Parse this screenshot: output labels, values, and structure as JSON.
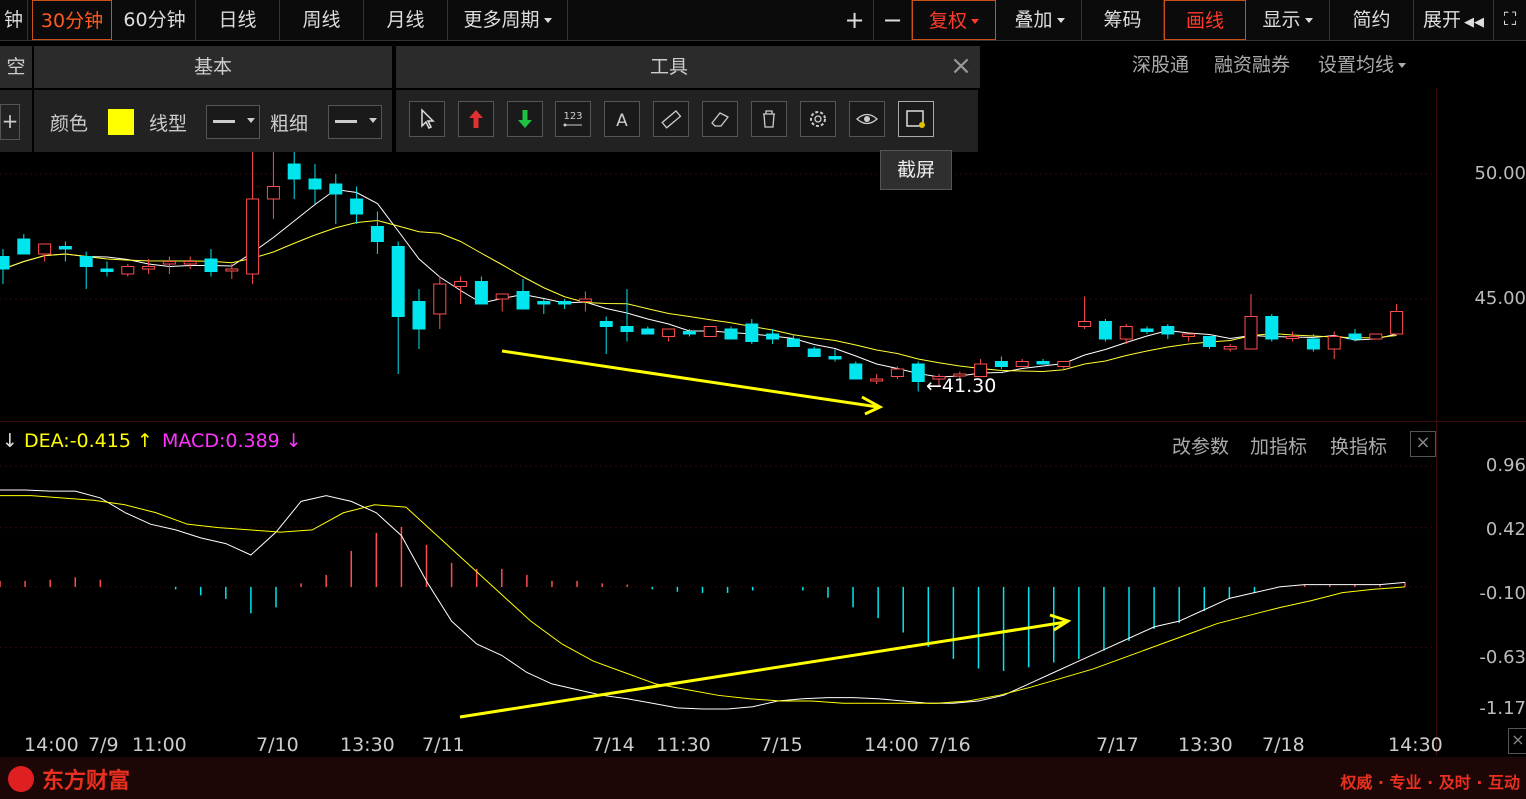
{
  "topbar": {
    "items": [
      {
        "label": "钟"
      },
      {
        "label": "30分钟",
        "active": true
      },
      {
        "label": "60分钟"
      },
      {
        "label": "日线"
      },
      {
        "label": "周线"
      },
      {
        "label": "月线"
      },
      {
        "label": "更多周期"
      }
    ],
    "right": {
      "plus": "+",
      "minus": "−",
      "fuquan": "复权",
      "diejia": "叠加",
      "chouma": "筹码",
      "huaxian": "画线",
      "xianshi": "显示",
      "jianyue": "简约",
      "zhankai": "展开"
    }
  },
  "draw_panel": {
    "tab_left": "空",
    "tab_basic": "基本",
    "tab_tools": "工具",
    "color_label": "颜色",
    "color_value": "#ffff00",
    "linetype_label": "线型",
    "thickness_label": "粗细",
    "tooltip": "截屏",
    "tools_icons": [
      "cursor-icon",
      "red-arrow-up-icon",
      "green-arrow-down-icon",
      "number-123-icon",
      "text-a-icon",
      "ruler-icon",
      "eraser-icon",
      "trash-icon",
      "settings-icon",
      "eye-icon",
      "screenshot-icon"
    ]
  },
  "chart_links": {
    "sgt": "深股通",
    "rzrq": "融资融券",
    "setma": "设置均线"
  },
  "price_axis": [
    "50.00",
    "45.00"
  ],
  "low_annotation": "←41.30",
  "macd_header": {
    "dea": "DEA:-0.415",
    "dea_arrow": "↑",
    "macd": "MACD:0.389",
    "macd_arrow": "↓",
    "left_arrow": "↓"
  },
  "macd_links": {
    "params": "改参数",
    "add": "加指标",
    "swap": "换指标"
  },
  "macd_axis": [
    "0.96",
    "0.42",
    "-0.10",
    "-0.63",
    "-1.17"
  ],
  "time_axis": [
    "14:00",
    "7/9",
    "11:00",
    "7/10",
    "13:30",
    "7/11",
    "7/14",
    "11:30",
    "7/15",
    "14:00",
    "7/16",
    "7/17",
    "13:30",
    "7/18",
    "14:30"
  ],
  "footer": {
    "brand": "东方财富",
    "slogan": "权威 · 专业 · 及时 · 互动"
  },
  "colors": {
    "up": "#ff4d4d",
    "down": "#00e5ee",
    "ma1": "#ffffff",
    "ma2": "#ffff33",
    "accent": "#ff5a1f",
    "dea": "#ffff00",
    "macd": "#ff00ff"
  },
  "chart_data": {
    "type": "candlestick",
    "yrange": [
      40,
      51
    ],
    "candles": [
      {
        "o": 46.7,
        "h": 47.0,
        "l": 45.6,
        "c": 46.2
      },
      {
        "o": 47.4,
        "h": 47.6,
        "l": 46.8,
        "c": 46.8
      },
      {
        "o": 46.8,
        "h": 47.2,
        "l": 46.5,
        "c": 47.2
      },
      {
        "o": 47.1,
        "h": 47.3,
        "l": 46.5,
        "c": 47.0
      },
      {
        "o": 46.7,
        "h": 46.9,
        "l": 45.4,
        "c": 46.3
      },
      {
        "o": 46.2,
        "h": 46.5,
        "l": 45.9,
        "c": 46.1
      },
      {
        "o": 46.0,
        "h": 46.4,
        "l": 45.9,
        "c": 46.3
      },
      {
        "o": 46.2,
        "h": 46.6,
        "l": 46.0,
        "c": 46.3
      },
      {
        "o": 46.4,
        "h": 46.7,
        "l": 46.0,
        "c": 46.5
      },
      {
        "o": 46.4,
        "h": 46.7,
        "l": 46.2,
        "c": 46.5
      },
      {
        "o": 46.6,
        "h": 47.0,
        "l": 45.9,
        "c": 46.1
      },
      {
        "o": 46.2,
        "h": 46.4,
        "l": 45.8,
        "c": 46.2
      },
      {
        "o": 46.0,
        "h": 51.0,
        "l": 45.6,
        "c": 49.0
      },
      {
        "o": 49.0,
        "h": 51.0,
        "l": 48.2,
        "c": 49.5
      },
      {
        "o": 50.4,
        "h": 51.0,
        "l": 49.0,
        "c": 49.8
      },
      {
        "o": 49.8,
        "h": 50.4,
        "l": 48.8,
        "c": 49.4
      },
      {
        "o": 49.6,
        "h": 50.0,
        "l": 48.0,
        "c": 49.2
      },
      {
        "o": 49.0,
        "h": 49.5,
        "l": 48.0,
        "c": 48.4
      },
      {
        "o": 47.9,
        "h": 48.5,
        "l": 46.8,
        "c": 47.3
      },
      {
        "o": 47.1,
        "h": 47.3,
        "l": 42.0,
        "c": 44.3
      },
      {
        "o": 44.9,
        "h": 45.4,
        "l": 43.0,
        "c": 43.8
      },
      {
        "o": 44.4,
        "h": 45.9,
        "l": 43.8,
        "c": 45.6
      },
      {
        "o": 45.5,
        "h": 45.9,
        "l": 44.8,
        "c": 45.7
      },
      {
        "o": 45.7,
        "h": 45.9,
        "l": 44.8,
        "c": 44.8
      },
      {
        "o": 45.0,
        "h": 45.2,
        "l": 44.5,
        "c": 45.2
      },
      {
        "o": 45.3,
        "h": 45.8,
        "l": 44.6,
        "c": 44.6
      },
      {
        "o": 44.9,
        "h": 45.0,
        "l": 44.4,
        "c": 44.8
      },
      {
        "o": 44.9,
        "h": 45.0,
        "l": 44.6,
        "c": 44.8
      },
      {
        "o": 44.9,
        "h": 45.3,
        "l": 44.5,
        "c": 45.0
      },
      {
        "o": 44.1,
        "h": 44.3,
        "l": 42.8,
        "c": 43.9
      },
      {
        "o": 43.9,
        "h": 45.4,
        "l": 43.3,
        "c": 43.7
      },
      {
        "o": 43.8,
        "h": 43.9,
        "l": 43.6,
        "c": 43.6
      },
      {
        "o": 43.5,
        "h": 43.8,
        "l": 43.3,
        "c": 43.8
      },
      {
        "o": 43.7,
        "h": 43.8,
        "l": 43.5,
        "c": 43.6
      },
      {
        "o": 43.5,
        "h": 43.9,
        "l": 43.5,
        "c": 43.9
      },
      {
        "o": 43.8,
        "h": 43.9,
        "l": 43.4,
        "c": 43.4
      },
      {
        "o": 44.0,
        "h": 44.2,
        "l": 43.2,
        "c": 43.3
      },
      {
        "o": 43.6,
        "h": 43.8,
        "l": 43.2,
        "c": 43.4
      },
      {
        "o": 43.4,
        "h": 43.6,
        "l": 43.1,
        "c": 43.1
      },
      {
        "o": 43.0,
        "h": 43.1,
        "l": 42.7,
        "c": 42.7
      },
      {
        "o": 42.7,
        "h": 43.0,
        "l": 42.5,
        "c": 42.6
      },
      {
        "o": 42.4,
        "h": 42.5,
        "l": 41.8,
        "c": 41.8
      },
      {
        "o": 41.8,
        "h": 42.0,
        "l": 41.6,
        "c": 41.8
      },
      {
        "o": 41.9,
        "h": 42.3,
        "l": 41.8,
        "c": 42.2
      },
      {
        "o": 42.4,
        "h": 42.5,
        "l": 41.3,
        "c": 41.7
      },
      {
        "o": 41.8,
        "h": 42.0,
        "l": 41.5,
        "c": 41.9
      },
      {
        "o": 42.0,
        "h": 42.1,
        "l": 41.8,
        "c": 42.0
      },
      {
        "o": 41.9,
        "h": 42.6,
        "l": 41.9,
        "c": 42.4
      },
      {
        "o": 42.5,
        "h": 42.7,
        "l": 42.2,
        "c": 42.3
      },
      {
        "o": 42.3,
        "h": 42.6,
        "l": 42.3,
        "c": 42.5
      },
      {
        "o": 42.5,
        "h": 42.6,
        "l": 42.4,
        "c": 42.4
      },
      {
        "o": 42.3,
        "h": 42.5,
        "l": 42.2,
        "c": 42.5
      },
      {
        "o": 43.9,
        "h": 45.1,
        "l": 43.8,
        "c": 44.1
      },
      {
        "o": 44.1,
        "h": 44.2,
        "l": 43.3,
        "c": 43.4
      },
      {
        "o": 43.4,
        "h": 44.0,
        "l": 43.2,
        "c": 43.9
      },
      {
        "o": 43.8,
        "h": 43.9,
        "l": 43.6,
        "c": 43.7
      },
      {
        "o": 43.9,
        "h": 44.0,
        "l": 43.4,
        "c": 43.6
      },
      {
        "o": 43.5,
        "h": 43.6,
        "l": 43.3,
        "c": 43.6
      },
      {
        "o": 43.5,
        "h": 43.5,
        "l": 43.0,
        "c": 43.1
      },
      {
        "o": 43.0,
        "h": 43.2,
        "l": 42.9,
        "c": 43.1
      },
      {
        "o": 43.0,
        "h": 45.2,
        "l": 43.0,
        "c": 44.3
      },
      {
        "o": 44.3,
        "h": 44.4,
        "l": 43.3,
        "c": 43.4
      },
      {
        "o": 43.5,
        "h": 43.7,
        "l": 43.3,
        "c": 43.5
      },
      {
        "o": 43.4,
        "h": 43.6,
        "l": 42.9,
        "c": 43.0
      },
      {
        "o": 43.0,
        "h": 43.7,
        "l": 42.6,
        "c": 43.5
      },
      {
        "o": 43.6,
        "h": 43.8,
        "l": 43.3,
        "c": 43.4
      },
      {
        "o": 43.4,
        "h": 43.6,
        "l": 43.4,
        "c": 43.6
      },
      {
        "o": 43.6,
        "h": 44.8,
        "l": 43.6,
        "c": 44.5
      }
    ],
    "dif": [
      0.75,
      0.75,
      0.74,
      0.74,
      0.68,
      0.55,
      0.45,
      0.4,
      0.33,
      0.28,
      0.18,
      0.38,
      0.65,
      0.7,
      0.65,
      0.55,
      0.35,
      -0.05,
      -0.4,
      -0.6,
      -0.7,
      -0.85,
      -0.95,
      -1.0,
      -1.05,
      -1.08,
      -1.12,
      -1.16,
      -1.17,
      -1.17,
      -1.15,
      -1.1,
      -1.08,
      -1.07,
      -1.07,
      -1.08,
      -1.1,
      -1.12,
      -1.12,
      -1.1,
      -1.05,
      -0.95,
      -0.85,
      -0.75,
      -0.65,
      -0.55,
      -0.45,
      -0.4,
      -0.3,
      -0.2,
      -0.15,
      -0.1,
      -0.08,
      -0.08,
      -0.08,
      -0.08,
      -0.06
    ],
    "dea": [
      0.7,
      0.7,
      0.68,
      0.66,
      0.62,
      0.55,
      0.45,
      0.42,
      0.4,
      0.38,
      0.4,
      0.55,
      0.62,
      0.6,
      0.35,
      0.1,
      -0.15,
      -0.4,
      -0.6,
      -0.75,
      -0.85,
      -0.95,
      -1.0,
      -1.05,
      -1.08,
      -1.1,
      -1.1,
      -1.12,
      -1.12,
      -1.12,
      -1.12,
      -1.1,
      -1.05,
      -0.98,
      -0.9,
      -0.82,
      -0.72,
      -0.62,
      -0.52,
      -0.42,
      -0.35,
      -0.28,
      -0.22,
      -0.15,
      -0.12,
      -0.1
    ]
  }
}
